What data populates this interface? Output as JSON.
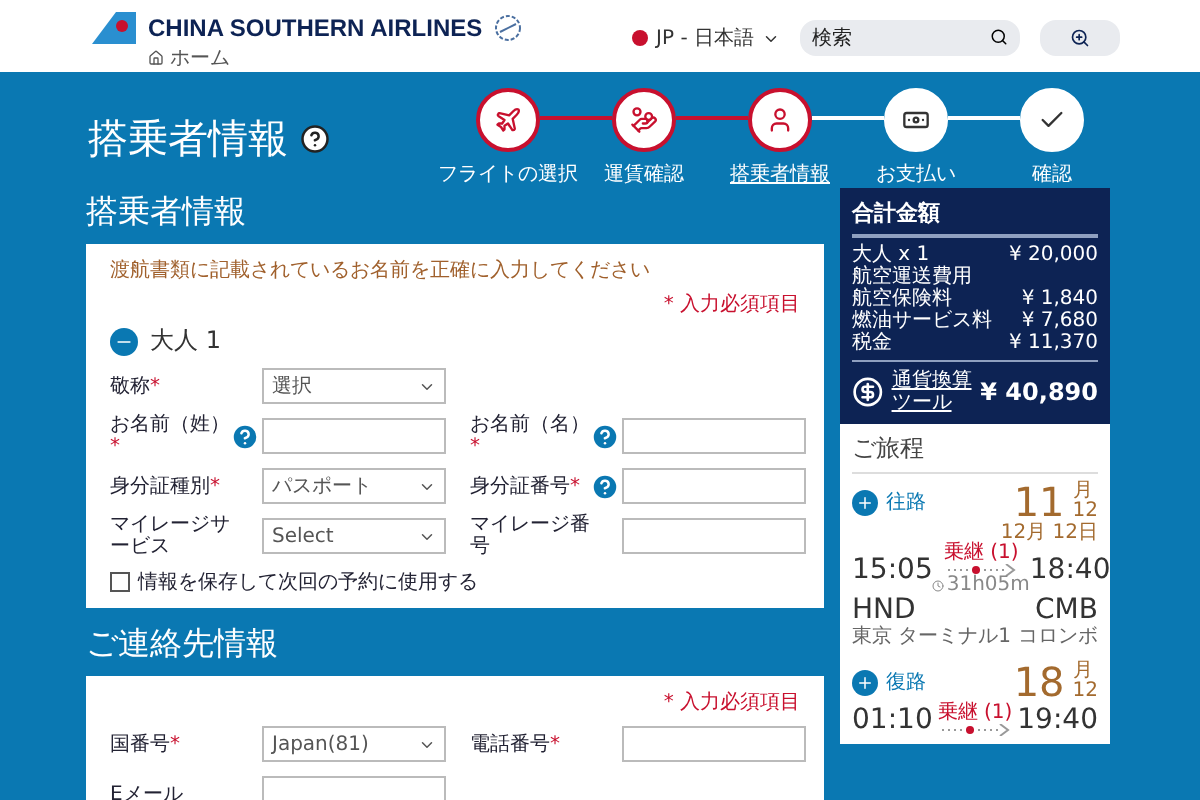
{
  "header": {
    "brand": "CHINA SOUTHERN AIRLINES",
    "breadcrumb": "ホーム",
    "language": "JP - 日本語",
    "search": {
      "placeholder": "検索"
    }
  },
  "page_title": "搭乗者情報",
  "steps": [
    {
      "label": "フライトの選択",
      "done": true,
      "selected": false
    },
    {
      "label": "運賃確認",
      "done": true,
      "selected": false
    },
    {
      "label": "搭乗者情報",
      "done": true,
      "selected": true
    },
    {
      "label": "お支払い",
      "done": false,
      "selected": false
    },
    {
      "label": "確認",
      "done": false,
      "selected": false
    }
  ],
  "passenger": {
    "title": "搭乗者情報",
    "notice": "渡航書類に記載されているお名前を正確に入力してください",
    "required_note": "* 入力必須項目",
    "adult": {
      "label": "大人 1",
      "expanded": true
    },
    "rows": [
      {
        "left": {
          "label": "敬称",
          "mark": "*",
          "help": false,
          "kind": "select",
          "value": "選択"
        }
      },
      {
        "left": {
          "label": "お名前（姓）",
          "mark": "*",
          "help": true,
          "kind": "text"
        },
        "right": {
          "label": "お名前（名）",
          "mark": "*",
          "help": true,
          "kind": "text"
        }
      },
      {
        "left": {
          "label": "身分証種別",
          "mark": "*",
          "help": false,
          "kind": "select",
          "value": "パスポート"
        },
        "right": {
          "label": "身分証番号",
          "mark": "*",
          "help": true,
          "kind": "text"
        }
      },
      {
        "left": {
          "label": "マイレージサービス",
          "help": false,
          "kind": "select",
          "value": "Select"
        },
        "right": {
          "label": "マイレージ番号",
          "help": false,
          "kind": "text"
        }
      }
    ],
    "save": {
      "label": "情報を保存して次回の予約に使用する",
      "checked": false
    }
  },
  "contact": {
    "title": "ご連絡先情報",
    "required_note": "* 入力必須項目",
    "rows": [
      {
        "left": {
          "label": "国番号",
          "mark": "*",
          "help": false,
          "kind": "select",
          "value": "Japan(81)"
        },
        "right": {
          "label": "電話番号",
          "mark": "*",
          "help": false,
          "kind": "text"
        }
      },
      {
        "left": {
          "label": "Eメール",
          "help": false,
          "kind": "text"
        }
      }
    ]
  },
  "summary": {
    "title": "合計金額",
    "items": [
      {
        "label": "大人 x 1",
        "value": "¥ 20,000"
      },
      {
        "label": "航空運送費用"
      },
      {
        "label": "航空保険料",
        "value": "¥ 1,840"
      },
      {
        "label": "燃油サービス料",
        "value": "¥ 7,680"
      },
      {
        "label": "税金",
        "value": "¥ 11,370"
      }
    ],
    "converter": "通貨換算ツール",
    "total": "¥ 40,890"
  },
  "itinerary": {
    "title": "ご旅程",
    "legs": [
      {
        "label": "往路",
        "expanded": false,
        "day": "11",
        "month_label": "月",
        "month": "12",
        "arrival_date": "12月 12日",
        "dep_time": "15:05",
        "dep_code": "HND",
        "dep_city": "東京 ターミナル1",
        "stop": "乗継 (1)",
        "duration": "31h05m",
        "arr_time": "18:40",
        "arr_code": "CMB",
        "arr_city": "コロンボ"
      },
      {
        "label": "復路",
        "expanded": false,
        "day": "18",
        "month_label": "月",
        "month": "12",
        "dep_time": "01:10",
        "stop": "乗継 (1)",
        "arr_time": "19:40"
      }
    ]
  }
}
